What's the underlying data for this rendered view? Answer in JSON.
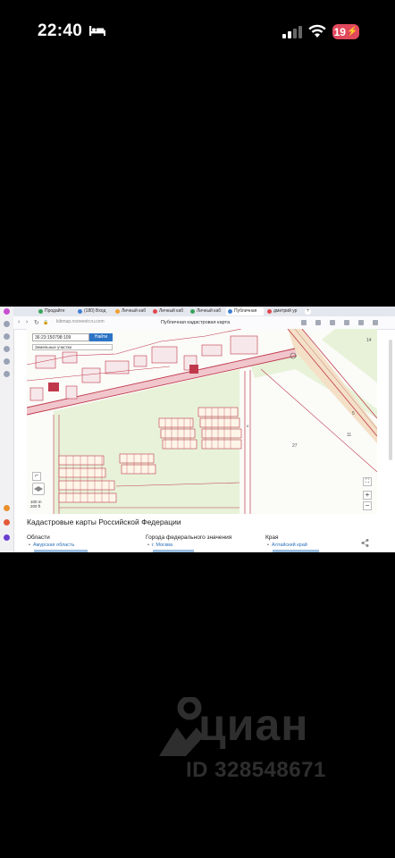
{
  "status_bar": {
    "time": "22:40",
    "battery": "19",
    "icons": [
      "bed-icon",
      "signal-icon",
      "wifi-icon",
      "battery-charging-icon"
    ]
  },
  "browser": {
    "tabs": [
      {
        "label": "Продайте",
        "color": "#3aa35a"
      },
      {
        "label": "(180) Вход",
        "color": "#3f7fd1"
      },
      {
        "label": "Личный каб",
        "color": "#f0a030"
      },
      {
        "label": "Личный каб",
        "color": "#e0484e"
      },
      {
        "label": "Личный каб",
        "color": "#3aa35a"
      },
      {
        "label": "Публичная",
        "color": "#3f7fd1",
        "active": true
      },
      {
        "label": "дмитрий ур",
        "color": "#e0484e"
      }
    ],
    "url": "kibmap.rosreestr.ru.com",
    "page_title": "Публичная кадастровая карта"
  },
  "map": {
    "search_value": "36:23:150798:109",
    "find_button": "Найти",
    "layer_dropdown": "Земельные участки",
    "scale_top": "100 m",
    "scale_bottom": "200 ft",
    "zoom_in": "+",
    "zoom_out": "−",
    "fullscreen": "⛶",
    "parcel_labels": [
      "27",
      "11",
      "5",
      "14",
      "8"
    ]
  },
  "page": {
    "heading": "Кадастровые карты Российской Федерации",
    "columns": [
      {
        "title": "Области",
        "first_link": "Амурская область"
      },
      {
        "title": "Города федерального значения",
        "first_link": "г. Москва"
      },
      {
        "title": "Края",
        "first_link": "Алтайский край"
      }
    ]
  },
  "watermark": {
    "brand": "циан",
    "id_text": "ID 328548671"
  },
  "colors": {
    "status_bg": "#000000",
    "battery": "#e0485c",
    "map_green": "#e7f2d8",
    "parcel_line": "#c0394b",
    "link": "#2b6fb8",
    "button": "#2c74c5"
  }
}
